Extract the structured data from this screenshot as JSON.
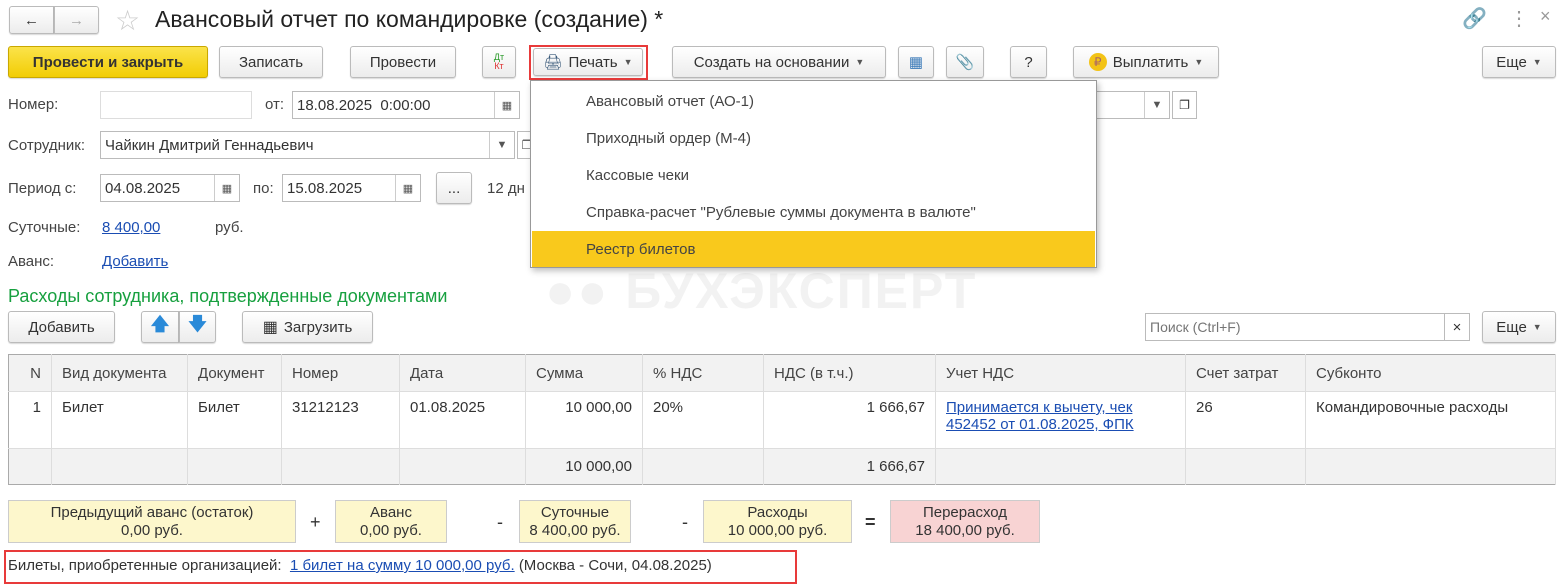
{
  "title": "Авансовый отчет по командировке (создание) *",
  "toolbar": {
    "post_close": "Провести и закрыть",
    "save": "Записать",
    "post": "Провести",
    "dt": "Дт",
    "kt": "Кт",
    "print": "Печать",
    "create_based": "Создать на основании",
    "help": "?",
    "pay": "Выплатить",
    "more": "Еще"
  },
  "print_menu": [
    "Авансовый отчет (АО-1)",
    "Приходный ордер (М-4)",
    "Кассовые чеки",
    "Справка-расчет \"Рублевые суммы документа в валюте\"",
    "Реестр билетов"
  ],
  "form": {
    "number_label": "Номер:",
    "number_value": "",
    "from_label": "от:",
    "date": "18.08.2025  0:00:00",
    "employee_label": "Сотрудник:",
    "employee": "Чайкин Дмитрий Геннадьевич",
    "period_label": "Период с:",
    "period_from": "04.08.2025",
    "to_label": "по:",
    "period_to": "15.08.2025",
    "period_btn": "...",
    "days": "12 дн",
    "per_diem_label": "Суточные:",
    "per_diem": "8 400,00",
    "currency": "руб.",
    "advance_label": "Аванс:",
    "advance_link": "Добавить"
  },
  "watermark": "БУХЭКСПЕРТ",
  "expenses": {
    "heading": "Расходы сотрудника, подтвержденные документами",
    "add": "Добавить",
    "load": "Загрузить",
    "search_placeholder": "Поиск (Ctrl+F)",
    "more": "Еще",
    "columns": [
      "N",
      "Вид документа",
      "Документ",
      "Номер",
      "Дата",
      "Сумма",
      "% НДС",
      "НДС (в т.ч.)",
      "Учет НДС",
      "Счет затрат",
      "Субконто"
    ],
    "rows": [
      {
        "n": "1",
        "type": "Билет",
        "doc": "Билет",
        "number": "31212123",
        "date": "01.08.2025",
        "sum": "10 000,00",
        "vat_rate": "20%",
        "vat": "1 666,67",
        "vat_acc": "Принимается к вычету, чек 452452 от 01.08.2025, ФПК",
        "account": "26",
        "subconto": "Командировочные расходы"
      }
    ],
    "totals": {
      "sum": "10 000,00",
      "vat": "1 666,67"
    }
  },
  "summary": {
    "prev_label": "Предыдущий аванс (остаток)",
    "prev": "0,00 руб.",
    "adv_label": "Аванс",
    "adv": "0,00 руб.",
    "perdiem_label": "Суточные",
    "perdiem": "8 400,00 руб.",
    "exp_label": "Расходы",
    "exp": "10 000,00 руб.",
    "over_label": "Перерасход",
    "over": "18 400,00 руб.",
    "ops": [
      "+",
      "-",
      "-",
      "="
    ]
  },
  "tickets": {
    "label": "Билеты, приобретенные организацией:",
    "link": "1 билет на сумму 10 000,00 руб.",
    "route": "(Москва - Сочи, 04.08.2025)"
  },
  "colors": {
    "accent": "#f9c91c",
    "heading": "#17a03f",
    "highlight": "#e83a3a",
    "overspend": "#f8d3d3"
  }
}
